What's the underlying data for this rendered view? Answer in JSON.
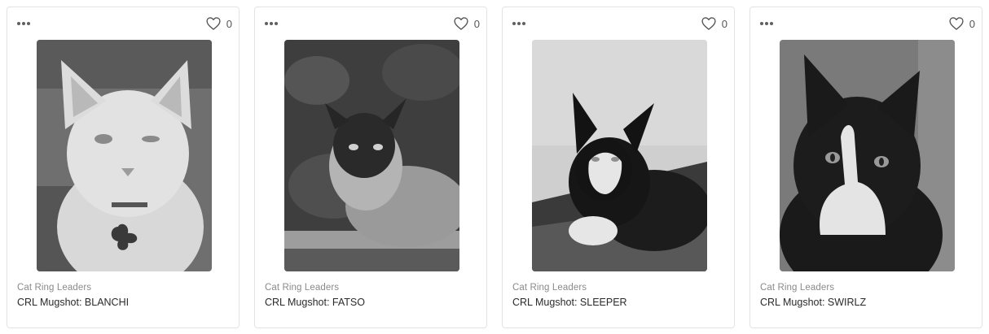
{
  "cards": [
    {
      "collection": "Cat Ring Leaders",
      "title": "CRL Mugshot: BLANCHI",
      "likes": "0",
      "image": "white cat with collar tag"
    },
    {
      "collection": "Cat Ring Leaders",
      "title": "CRL Mugshot: FATSO",
      "likes": "0",
      "image": "siamese cat lying down"
    },
    {
      "collection": "Cat Ring Leaders",
      "title": "CRL Mugshot: SLEEPER",
      "likes": "0",
      "image": "black and white cat resting"
    },
    {
      "collection": "Cat Ring Leaders",
      "title": "CRL Mugshot: SWIRLZ",
      "likes": "0",
      "image": "black and white cat portrait"
    }
  ],
  "icons": {
    "more": "more-horizontal-icon",
    "like": "heart-icon"
  }
}
